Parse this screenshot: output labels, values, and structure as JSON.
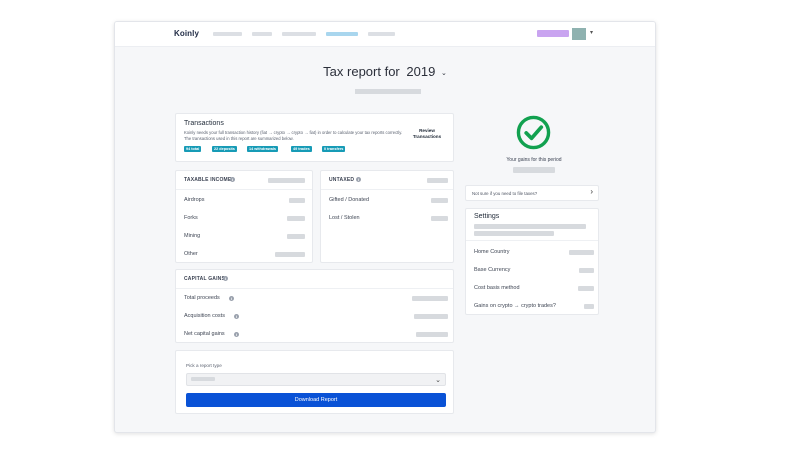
{
  "nav": {
    "logo": "Koinly",
    "links": [
      {
        "name": "nav-link-1",
        "active": false
      },
      {
        "name": "nav-link-2",
        "active": false
      },
      {
        "name": "nav-link-3",
        "active": false
      },
      {
        "name": "nav-link-tax-reports",
        "active": true
      },
      {
        "name": "nav-link-5",
        "active": false
      }
    ],
    "caret": "▾"
  },
  "header": {
    "title": "Tax report for",
    "year": "2019",
    "year_caret": "⌄"
  },
  "transactions": {
    "title": "Transactions",
    "description": "Koinly needs your full transaction history (fiat → crypto → crypto → fiat) in order to calculate your tax reports correctly. The transactions used in this report are summarized below.",
    "review_button": "Review Transactions",
    "badges": [
      "94 total",
      "22 deposits",
      "14 withdrawals",
      "49 trades",
      "0 transfers"
    ]
  },
  "taxable_income": {
    "header": "TAXABLE INCOME",
    "rows": [
      "Airdrops",
      "Forks",
      "Mining",
      "Other"
    ]
  },
  "untaxed": {
    "header": "UNTAXED",
    "rows": [
      "Gifted / Donated",
      "Lost / Stolen"
    ]
  },
  "capital_gains": {
    "header": "CAPITAL GAINS",
    "rows": [
      "Total proceeds",
      "Acquisition costs",
      "Net capital gains"
    ]
  },
  "report": {
    "pick_label": "Pick a report type",
    "download_label": "Download Report"
  },
  "status": {
    "gains_label": "Your gains for this period",
    "taxes_question": "Not sure if you need to file taxes?"
  },
  "settings": {
    "title": "Settings",
    "rows": [
      "Home Country",
      "Base Currency",
      "Cost basis method",
      "Gains on crypto → crypto trades?"
    ]
  },
  "colors": {
    "accent_blue": "#0a52d6",
    "badge_teal": "#179bb6",
    "check_green": "#12a150",
    "nav_active": "#a9d6ee"
  },
  "icons": {
    "info": "info-icon",
    "success": "check-circle-icon",
    "chevron": "chevron-right-icon",
    "dropdown": "chevron-down-icon"
  }
}
